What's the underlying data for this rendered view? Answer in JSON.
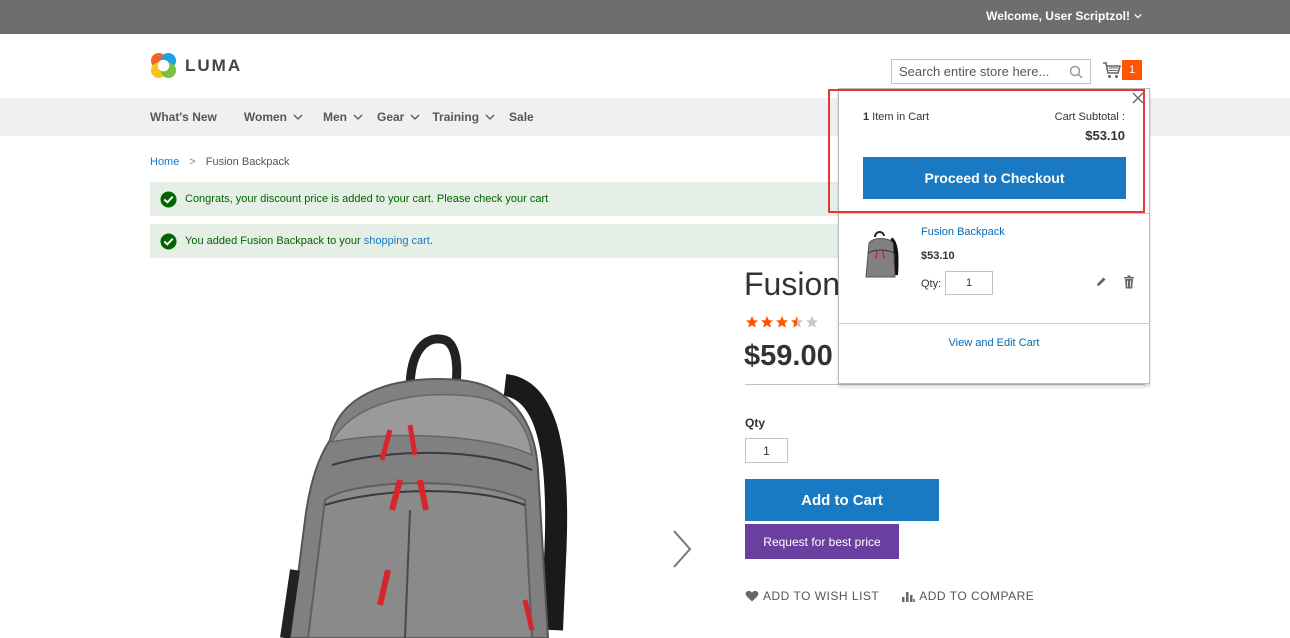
{
  "topbar": {
    "welcome_text": "Welcome, User Scriptzol!"
  },
  "header": {
    "logo_text": "LUMA",
    "search_placeholder": "Search entire store here...",
    "cart_count": "1"
  },
  "nav": {
    "items": [
      {
        "label": "What's New",
        "has_dropdown": false
      },
      {
        "label": "Women",
        "has_dropdown": true
      },
      {
        "label": "Men",
        "has_dropdown": true
      },
      {
        "label": "Gear",
        "has_dropdown": true
      },
      {
        "label": "Training",
        "has_dropdown": true
      },
      {
        "label": "Sale",
        "has_dropdown": false
      }
    ]
  },
  "breadcrumb": {
    "home": "Home",
    "separator": ">",
    "current": "Fusion Backpack"
  },
  "messages": {
    "discount": "Congrats, your discount price is added to your cart. Please check your cart",
    "added_prefix": "You added Fusion Backpack to your ",
    "added_link": "shopping cart",
    "added_suffix": "."
  },
  "product": {
    "title": "Fusion",
    "rating_stars": 3.5,
    "rating_max": 5,
    "price": "$59.00",
    "qty_label": "Qty",
    "qty_value": "1",
    "add_to_cart": "Add to Cart",
    "best_price": "Request for best price",
    "wishlist": "ADD TO WISH LIST",
    "compare": "ADD TO COMPARE"
  },
  "minicart": {
    "count": "1",
    "count_suffix": " Item in Cart",
    "subtotal_label": "Cart Subtotal :",
    "subtotal": "$53.10",
    "checkout": "Proceed to Checkout",
    "item_name": "Fusion Backpack",
    "item_price": "$53.10",
    "qty_label": "Qty:",
    "qty_value": "1",
    "view_edit": "View and Edit Cart"
  },
  "colors": {
    "accent": "#1979c3",
    "badge": "#ff5501",
    "star": "#ff5501",
    "purple": "#6a3fa0",
    "highlight": "#e53935",
    "success": "#006400"
  },
  "icons": [
    "chevron-down-icon",
    "search-icon",
    "cart-icon",
    "check-circle-icon",
    "chevron-right-icon",
    "star-icon",
    "heart-icon",
    "compare-icon",
    "close-icon",
    "edit-icon",
    "trash-icon"
  ]
}
